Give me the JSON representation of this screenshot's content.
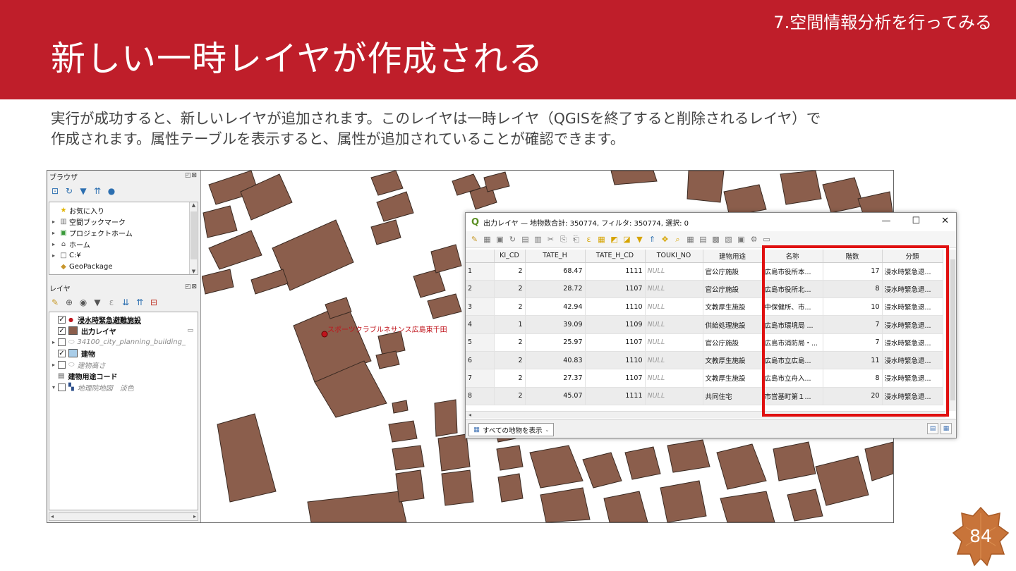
{
  "slide": {
    "section": "7.空間情報分析を行ってみる",
    "title": "新しい一時レイヤが作成される",
    "body_line1": "実行が成功すると、新しいレイヤが追加されます。このレイヤは一時レイヤ（QGISを終了すると削除されるレイヤ）で",
    "body_line2": "作成されます。属性テーブルを表示すると、属性が追加されていることが確認できます。",
    "page_number": "84",
    "colors": {
      "header": "#bf1e2a",
      "badge": "#c8743a",
      "highlight": "#e01010",
      "building": "#8b5e4c"
    }
  },
  "browser_panel": {
    "title": "ブラウザ",
    "items": [
      {
        "label": "お気に入り",
        "icon": "star-icon"
      },
      {
        "label": "空間ブックマーク",
        "icon": "bookmark-icon"
      },
      {
        "label": "プロジェクトホーム",
        "icon": "project-home-icon"
      },
      {
        "label": "ホーム",
        "icon": "home-folder-icon"
      },
      {
        "label": "C:¥",
        "icon": "drive-folder-icon"
      },
      {
        "label": "GeoPackage",
        "icon": "geopackage-icon"
      }
    ]
  },
  "layers_panel": {
    "title": "レイヤ",
    "items": [
      {
        "label": "浸水時緊急避難施設",
        "checked": "✓"
      },
      {
        "label": "出力レイヤ",
        "checked": "✓"
      },
      {
        "label": "34100_city_planning_building_",
        "checked": ""
      },
      {
        "label": "建物",
        "checked": "✓"
      },
      {
        "label": "建物高さ",
        "checked": ""
      },
      {
        "label": "建物用途コード"
      },
      {
        "label": "地理院地図　淡色",
        "checked": ""
      }
    ]
  },
  "map": {
    "label": "スポーツクラブルネサンス広島東千田"
  },
  "attribute_table": {
    "window_title": "出力レイヤ — 地物数合計: 350774, フィルタ: 350774, 選択: 0",
    "columns": [
      "",
      "KI_CD",
      "TATE_H",
      "TATE_H_CD",
      "TOUKI_NO",
      "建物用途",
      "名称",
      "階数",
      "分類"
    ],
    "rows": [
      [
        "1",
        "2",
        "68.47",
        "1111",
        "NULL",
        "官公庁施設",
        "広島市役所本...",
        "17",
        "浸水時緊急退..."
      ],
      [
        "2",
        "2",
        "28.72",
        "1107",
        "NULL",
        "官公庁施設",
        "広島市役所北...",
        "8",
        "浸水時緊急退..."
      ],
      [
        "3",
        "2",
        "42.94",
        "1110",
        "NULL",
        "文教厚生施設",
        "中保健所、市...",
        "10",
        "浸水時緊急退..."
      ],
      [
        "4",
        "1",
        "39.09",
        "1109",
        "NULL",
        "供給処理施設",
        "広島市環境局 ...",
        "7",
        "浸水時緊急退..."
      ],
      [
        "5",
        "2",
        "25.97",
        "1107",
        "NULL",
        "官公庁施設",
        "広島市消防局・...",
        "7",
        "浸水時緊急退..."
      ],
      [
        "6",
        "2",
        "40.83",
        "1110",
        "NULL",
        "文教厚生施設",
        "広島市立広島...",
        "11",
        "浸水時緊急退..."
      ],
      [
        "7",
        "2",
        "27.37",
        "1107",
        "NULL",
        "文教厚生施設",
        "広島市立舟入...",
        "8",
        "浸水時緊急退..."
      ],
      [
        "8",
        "2",
        "45.07",
        "1111",
        "NULL",
        "共同住宅",
        "市営基町第１...",
        "20",
        "浸水時緊急退..."
      ]
    ],
    "show_all_label": "すべての地物を表示"
  }
}
